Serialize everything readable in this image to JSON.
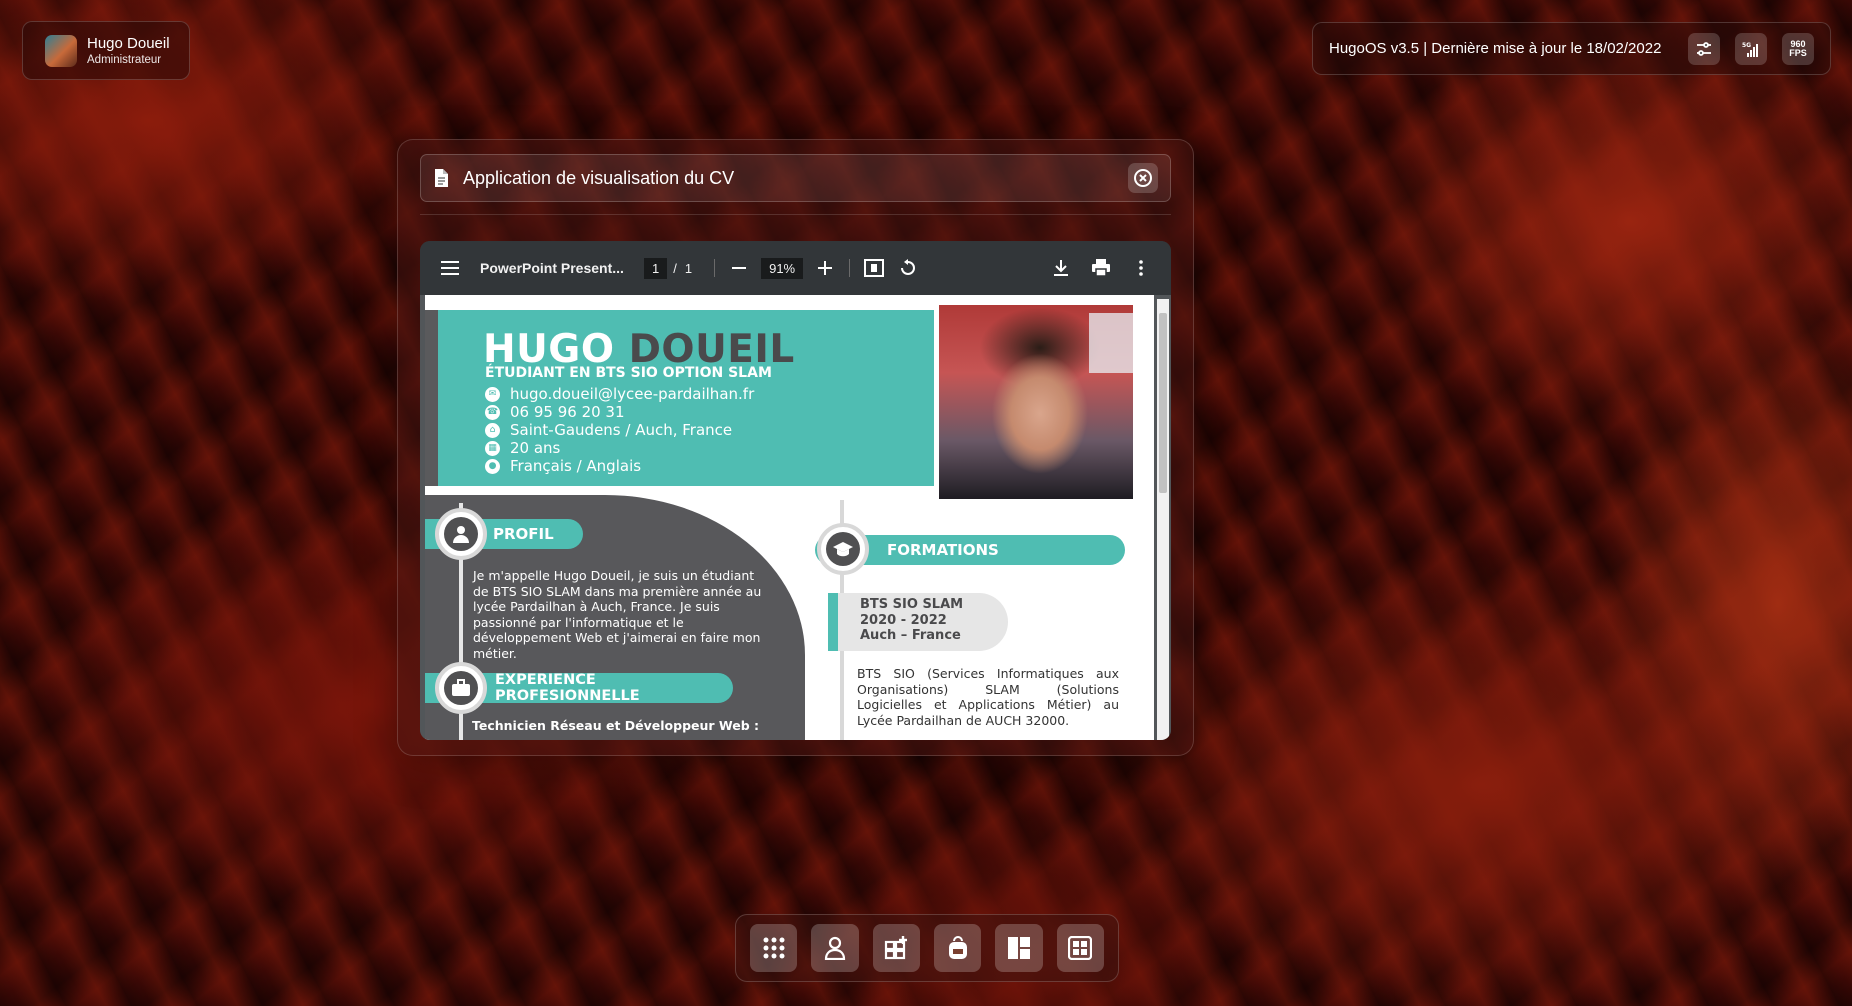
{
  "user": {
    "name": "Hugo Doueil",
    "role": "Administrateur"
  },
  "system": {
    "status_text": "HugoOS v3.5 | Dernière mise à jour le 18/02/2022",
    "buttons": [
      {
        "icon": "sliders-icon"
      },
      {
        "icon": "signal-5g-icon",
        "label": "5G"
      },
      {
        "icon": "fps-counter-icon",
        "label": "960 FPS"
      }
    ]
  },
  "window": {
    "title": "Application de visualisation du CV",
    "close_icon": "close-circle-icon"
  },
  "pdf_viewer": {
    "document_title": "PowerPoint Present...",
    "current_page": "1",
    "page_separator": "/",
    "total_pages": "1",
    "zoom": "91%"
  },
  "cv": {
    "first_name": "HUGO",
    "last_name": "DOUEIL",
    "subtitle": "ÉTUDIANT EN BTS SIO OPTION SLAM",
    "contacts": [
      {
        "icon": "mail-icon",
        "text": "hugo.doueil@lycee-pardailhan.fr"
      },
      {
        "icon": "phone-icon",
        "text": "06 95 96 20 31"
      },
      {
        "icon": "home-icon",
        "text": "Saint-Gaudens / Auch, France"
      },
      {
        "icon": "calendar-icon",
        "text": "20 ans"
      },
      {
        "icon": "language-icon",
        "text": "Français / Anglais"
      }
    ],
    "profile_title": "PROFIL",
    "profile_text": "Je m'appelle Hugo Doueil, je suis un étudiant de BTS SIO SLAM dans ma première année au lycée Pardailhan à Auch, France. Je suis passionné par l'informatique et le développement Web et j'aimerai en faire mon métier.",
    "experience_title": "EXPERIENCE PROFESIONNELLE",
    "experience_job": "Technicien Réseau et Développeur Web :",
    "formations_title": "FORMATIONS",
    "formation": {
      "degree": "BTS SIO SLAM",
      "years": "2020 - 2022",
      "place": "Auch – France",
      "description": "BTS SIO (Services Informatiques aux Organisations) SLAM (Solutions Logicielles et Applications Métier) au Lycée Pardailhan de AUCH 32000."
    }
  },
  "dock": [
    {
      "icon": "apps-grid-icon"
    },
    {
      "icon": "user-icon"
    },
    {
      "icon": "add-widget-icon"
    },
    {
      "icon": "backpack-icon"
    },
    {
      "icon": "layout-icon"
    },
    {
      "icon": "dashboard-icon"
    }
  ],
  "colors": {
    "teal": "#4fbdb2",
    "dark_grey": "#58585b"
  }
}
